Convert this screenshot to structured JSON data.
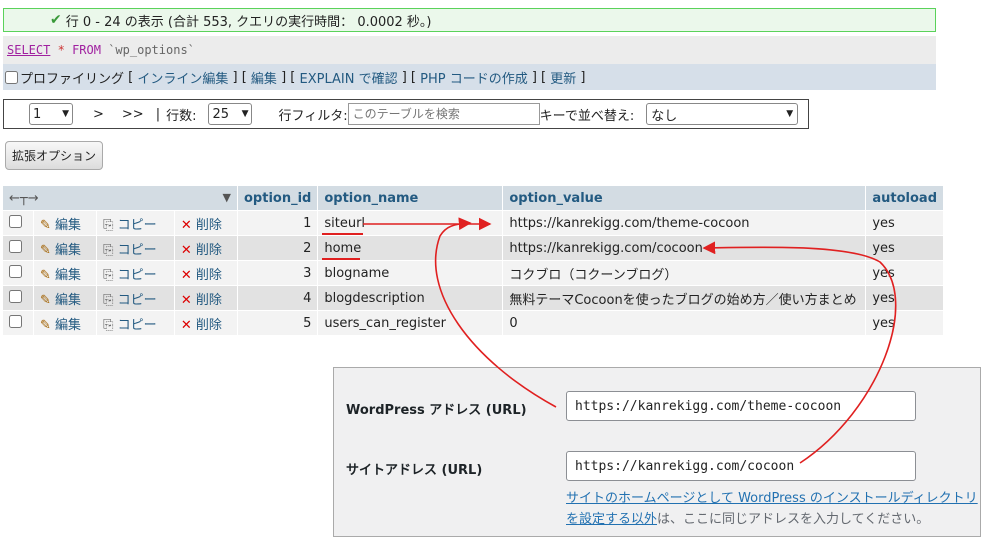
{
  "success_message": "行 0 - 24 の表示 (合計 553, クエリの実行時間： 0.0002 秒。)",
  "sql": {
    "select": "SELECT",
    "star": "*",
    "from": "FROM",
    "table": "`wp_options`"
  },
  "toolbar": {
    "profiling": "プロファイリング",
    "inline_edit": "インライン編集",
    "edit": "編集",
    "explain": "EXPLAIN で確認",
    "php_code": "PHP コードの作成",
    "refresh": "更新"
  },
  "nav": {
    "page_value": "1",
    "next": ">",
    "last": ">>",
    "rows_label": "行数:",
    "rows_value": "25",
    "filter_label": "行フィルタ:",
    "filter_placeholder": "このテーブルを検索",
    "sort_label": "キーで並べ替え:",
    "sort_value": "なし"
  },
  "extended_options": "拡張オプション",
  "table": {
    "columns": [
      "option_id",
      "option_name",
      "option_value",
      "autoload"
    ],
    "actions": {
      "edit": "編集",
      "copy": "コピー",
      "delete": "削除"
    },
    "rows": [
      {
        "id": "1",
        "name": "siteurl",
        "value": "https://kanrekigg.com/theme-cocoon",
        "autoload": "yes"
      },
      {
        "id": "2",
        "name": "home",
        "value": "https://kanrekigg.com/cocoon",
        "autoload": "yes"
      },
      {
        "id": "3",
        "name": "blogname",
        "value": "コクブロ（コクーンブログ）",
        "autoload": "yes"
      },
      {
        "id": "4",
        "name": "blogdescription",
        "value": "無料テーマCocoonを使ったブログの始め方／使い方まとめ",
        "autoload": "yes"
      },
      {
        "id": "5",
        "name": "users_can_register",
        "value": "0",
        "autoload": "yes"
      }
    ]
  },
  "wp_settings": {
    "wp_address_label": "WordPress アドレス (URL)",
    "wp_address_value": "https://kanrekigg.com/theme-cocoon",
    "site_address_label": "サイトアドレス (URL)",
    "site_address_value": "https://kanrekigg.com/cocoon",
    "help_link_1": "サイトのホームページとして WordPress のインストールディレクトリ",
    "help_link_2": "を設定する以外",
    "help_rest": "は、ここに同じアドレスを入力してください。"
  },
  "colors": {
    "annotation_red": "#e02020",
    "header_bg": "#d3dce3",
    "link": "#235a81"
  }
}
